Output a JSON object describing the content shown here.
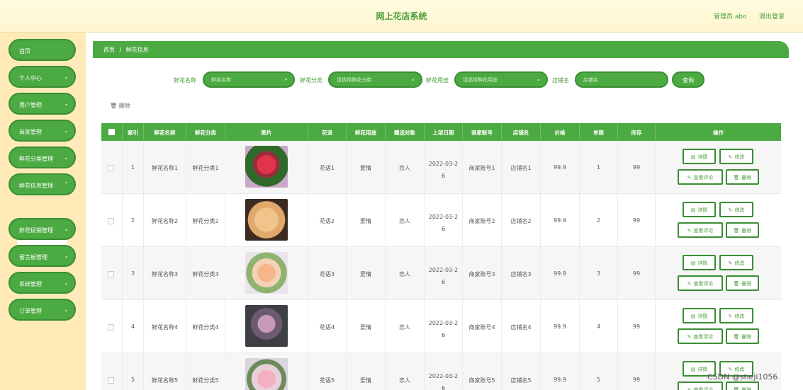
{
  "header": {
    "title": "网上花店系统",
    "admin": "管理员 abo",
    "logout": "退出登录"
  },
  "sidebar": {
    "items": [
      {
        "label": "首页",
        "chevron": false
      },
      {
        "label": "个人中心",
        "chevron": true
      },
      {
        "label": "用户管理",
        "chevron": true
      },
      {
        "label": "商家管理",
        "chevron": true
      },
      {
        "label": "鲜花分类管理",
        "chevron": true
      },
      {
        "label": "鲜花信息管理",
        "chevron": true
      },
      {
        "label": "鲜花促销管理",
        "chevron": true
      },
      {
        "label": "留言板管理",
        "chevron": true
      },
      {
        "label": "系统管理",
        "chevron": true
      },
      {
        "label": "订单管理",
        "chevron": true
      }
    ],
    "subitem": "鲜花信息"
  },
  "breadcrumb": {
    "home": "首页",
    "sep": "/",
    "current": "鲜花信息"
  },
  "search": {
    "name_label": "鲜花名称",
    "name_placeholder": "鲜花名称",
    "category_label": "鲜花分类",
    "category_placeholder": "请选择鲜花分类",
    "usage_label": "鲜花用途",
    "usage_placeholder": "请选择鲜花用途",
    "shop_label": "店铺名",
    "shop_placeholder": "店铺名",
    "query_button": "查询"
  },
  "toolbar": {
    "delete_label": "删除"
  },
  "table": {
    "columns": [
      "索引",
      "鲜花名称",
      "鲜花分类",
      "图片",
      "花语",
      "鲜花用途",
      "赠送对象",
      "上架日期",
      "商家账号",
      "店铺名",
      "价格",
      "单限",
      "库存",
      "操作"
    ],
    "rows": [
      {
        "index": "1",
        "name": "鲜花名称1",
        "category": "鲜花分类1",
        "language": "花语1",
        "usage": "爱情",
        "target": "恋人",
        "date_l1": "2022-03-2",
        "date_l2": "6",
        "merchant": "商家账号1",
        "shop": "店铺名1",
        "price": "99.9",
        "limit": "1",
        "stock": "99"
      },
      {
        "index": "2",
        "name": "鲜花名称2",
        "category": "鲜花分类2",
        "language": "花语2",
        "usage": "爱情",
        "target": "恋人",
        "date_l1": "2022-03-2",
        "date_l2": "6",
        "merchant": "商家账号2",
        "shop": "店铺名2",
        "price": "99.9",
        "limit": "2",
        "stock": "99"
      },
      {
        "index": "3",
        "name": "鲜花名称3",
        "category": "鲜花分类3",
        "language": "花语3",
        "usage": "爱情",
        "target": "恋人",
        "date_l1": "2022-03-2",
        "date_l2": "6",
        "merchant": "商家账号3",
        "shop": "店铺名3",
        "price": "99.9",
        "limit": "3",
        "stock": "99"
      },
      {
        "index": "4",
        "name": "鲜花名称4",
        "category": "鲜花分类4",
        "language": "花语4",
        "usage": "爱情",
        "target": "恋人",
        "date_l1": "2022-03-2",
        "date_l2": "6",
        "merchant": "商家账号4",
        "shop": "店铺名4",
        "price": "99.9",
        "limit": "4",
        "stock": "99"
      },
      {
        "index": "5",
        "name": "鲜花名称5",
        "category": "鲜花分类5",
        "language": "花语5",
        "usage": "爱情",
        "target": "恋人",
        "date_l1": "2022-03-2",
        "date_l2": "6",
        "merchant": "商家账号5",
        "shop": "店铺名5",
        "price": "99.9",
        "limit": "5",
        "stock": "99"
      }
    ],
    "actions": {
      "detail": "详情",
      "edit": "修改",
      "reviews": "查看评论",
      "delete": "删除"
    }
  },
  "watermark": "CSDN @sheji1056",
  "colors": {
    "accent": "#4caa42",
    "header_bg": "#fff8d6",
    "sidebar_bg": "#ffeab8"
  }
}
